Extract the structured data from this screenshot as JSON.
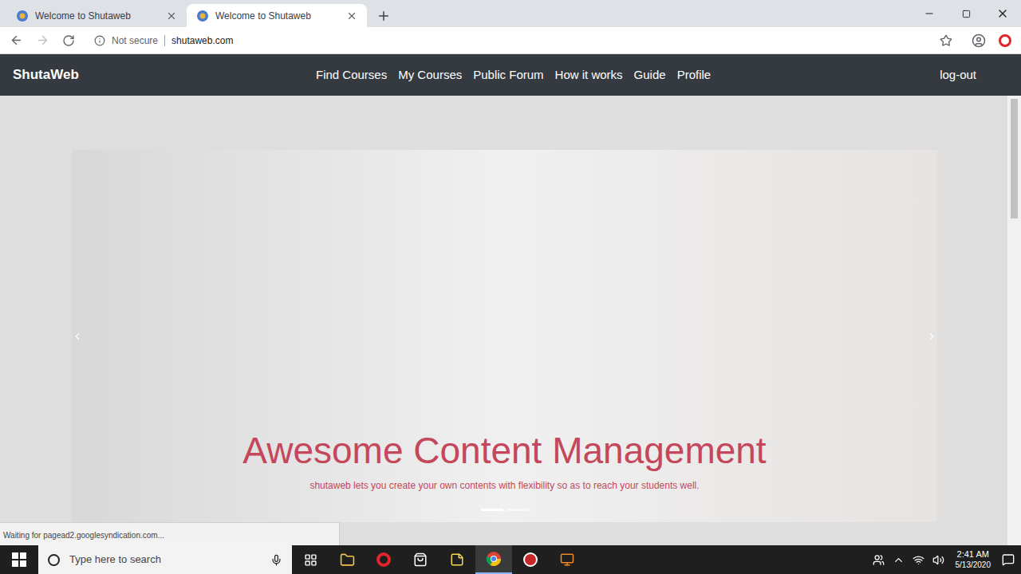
{
  "browser": {
    "tabs": [
      {
        "title": "Welcome to Shutaweb",
        "selected": false
      },
      {
        "title": "Welcome to Shutaweb",
        "selected": true
      }
    ],
    "address": {
      "security": "Not secure",
      "url": "shutaweb.com"
    },
    "status": "Waiting for pagead2.googlesyndication.com..."
  },
  "site": {
    "brand": "ShutaWeb",
    "nav": [
      "Find Courses",
      "My Courses",
      "Public Forum",
      "How it works",
      "Guide",
      "Profile"
    ],
    "logout": "log-out"
  },
  "carousel": {
    "title": "Awesome Content Management",
    "caption": "shutaweb lets you create your own contents with flexibility so as to reach your students well.",
    "indicators": [
      {
        "selected": true
      },
      {
        "selected": false
      }
    ]
  },
  "taskbar": {
    "search_placeholder": "Type here to search",
    "time": "2:41 AM",
    "date": "5/13/2020"
  }
}
